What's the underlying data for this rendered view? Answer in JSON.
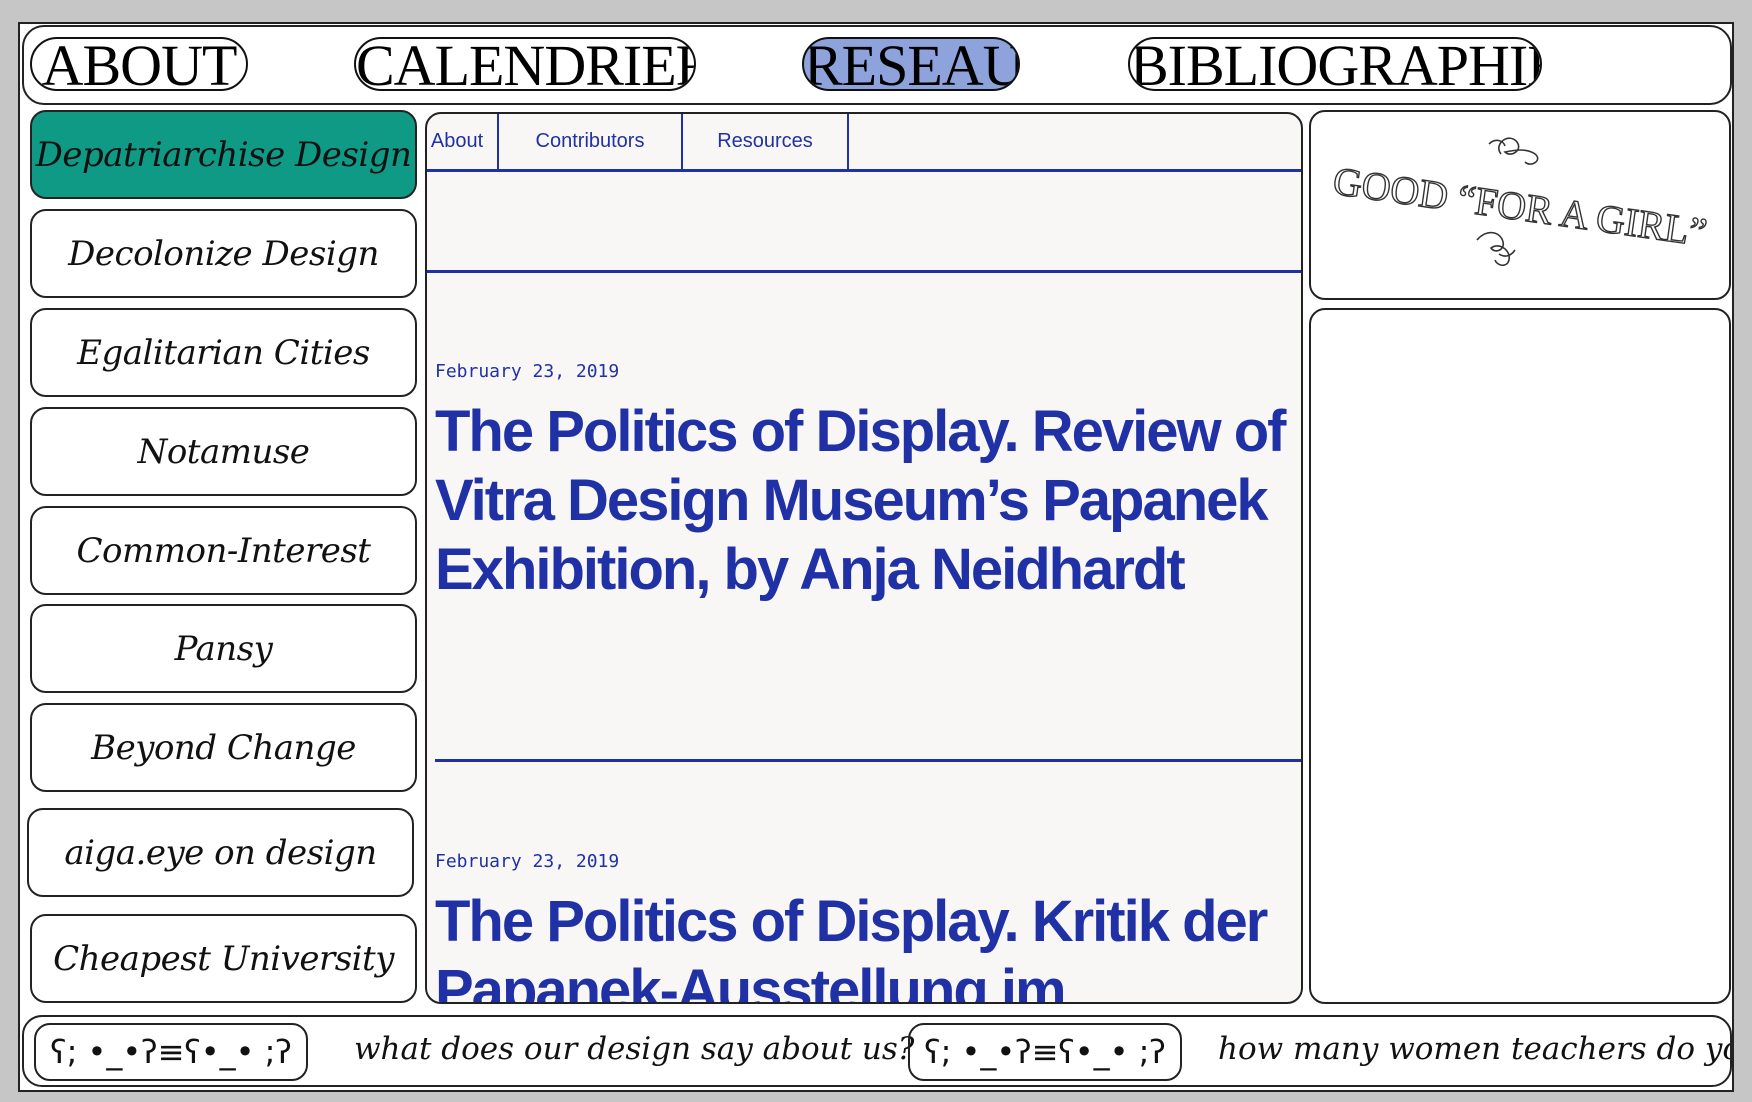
{
  "nav": {
    "items": [
      {
        "label": "ABOUT"
      },
      {
        "label": "CALENDRIER"
      },
      {
        "label": "RESEAU"
      },
      {
        "label": "BIBLIOGRAPHIE"
      }
    ],
    "active": "RESEAU",
    "active_color": "#8ea2dc"
  },
  "sidebar": {
    "items": [
      {
        "label": "Depatriarchise Design"
      },
      {
        "label": "Decolonize Design"
      },
      {
        "label": "Egalitarian Cities"
      },
      {
        "label": "Notamuse"
      },
      {
        "label": "Common-Interest"
      },
      {
        "label": "Pansy"
      },
      {
        "label": "Beyond Change"
      },
      {
        "label": "aiga.eye on design"
      },
      {
        "label": "Cheapest University"
      }
    ],
    "active": "Depatriarchise Design",
    "active_color": "#0f9a86"
  },
  "embed": {
    "tabs": [
      {
        "label": "About"
      },
      {
        "label": "Contributors"
      },
      {
        "label": "Resources"
      }
    ],
    "accent_color": "#2031a6",
    "posts": [
      {
        "date": "February 23, 2019",
        "title": "The Politics of Display. Review of Vitra Design Museum’s Papanek Exhibition, by Anja Neidhardt"
      },
      {
        "date": "February 23, 2019",
        "title": "The Politics of Display. Kritik der Papanek-Ausstellung im"
      }
    ]
  },
  "sticker": {
    "text": "GOOD “FOR A GIRL”",
    "icon": "flourish-icon"
  },
  "marquee": {
    "kaomoji": "ʕ; •_•ʔ≡ʕ•_• ;ʔ",
    "questions": [
      "what does our design say about us?",
      "how many women teachers do you"
    ]
  }
}
